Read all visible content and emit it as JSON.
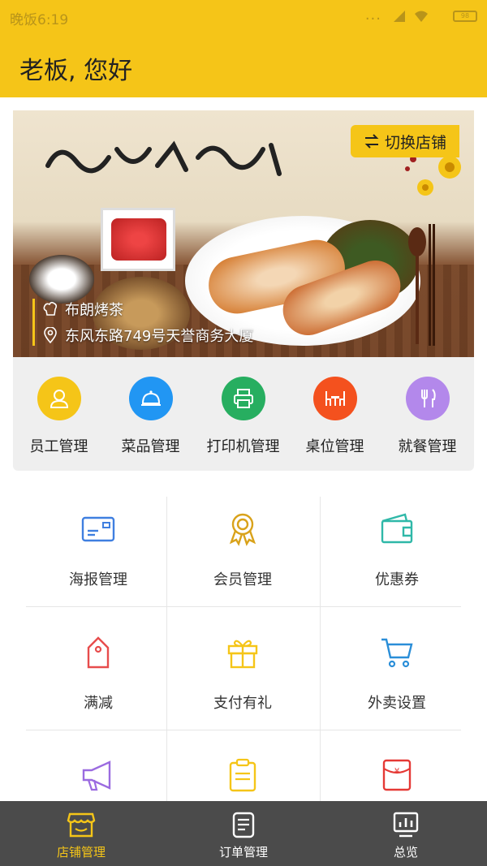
{
  "status_bar": {
    "time": "晚饭6:19",
    "dots": "...",
    "battery": "98"
  },
  "header": {
    "title": "老板, 您好"
  },
  "banner": {
    "switch_label": "切换店铺",
    "store_name": "布朗烤茶",
    "store_address": "东风东路749号天誉商务大厦"
  },
  "quick_actions": [
    {
      "label": "员工管理",
      "icon": "staff-icon",
      "color": "#f5c518"
    },
    {
      "label": "菜品管理",
      "icon": "dish-cover-icon",
      "color": "#2196f3"
    },
    {
      "label": "打印机管理",
      "icon": "printer-icon",
      "color": "#27ae60"
    },
    {
      "label": "桌位管理",
      "icon": "table-chairs-icon",
      "color": "#f4511e"
    },
    {
      "label": "就餐管理",
      "icon": "fork-knife-icon",
      "color": "#b388eb"
    }
  ],
  "features": [
    {
      "label": "海报管理",
      "icon": "poster-card-icon",
      "color": "#3f7fe0"
    },
    {
      "label": "会员管理",
      "icon": "member-badge-icon",
      "color": "#d9a21a"
    },
    {
      "label": "优惠券",
      "icon": "wallet-icon",
      "color": "#2fb8a8"
    },
    {
      "label": "满减",
      "icon": "price-tag-icon",
      "color": "#e74c4c"
    },
    {
      "label": "支付有礼",
      "icon": "gift-icon",
      "color": "#f5c518"
    },
    {
      "label": "外卖设置",
      "icon": "cart-icon",
      "color": "#2a8ed8"
    },
    {
      "label": "",
      "icon": "megaphone-icon",
      "color": "#9b6be0"
    },
    {
      "label": "",
      "icon": "clipboard-icon",
      "color": "#f5c518"
    },
    {
      "label": "",
      "icon": "red-envelope-icon",
      "color": "#e53935"
    }
  ],
  "tabs": [
    {
      "label": "店铺管理",
      "icon": "shop-icon",
      "active": true
    },
    {
      "label": "订单管理",
      "icon": "order-list-icon",
      "active": false
    },
    {
      "label": "总览",
      "icon": "dashboard-chart-icon",
      "active": false
    }
  ]
}
